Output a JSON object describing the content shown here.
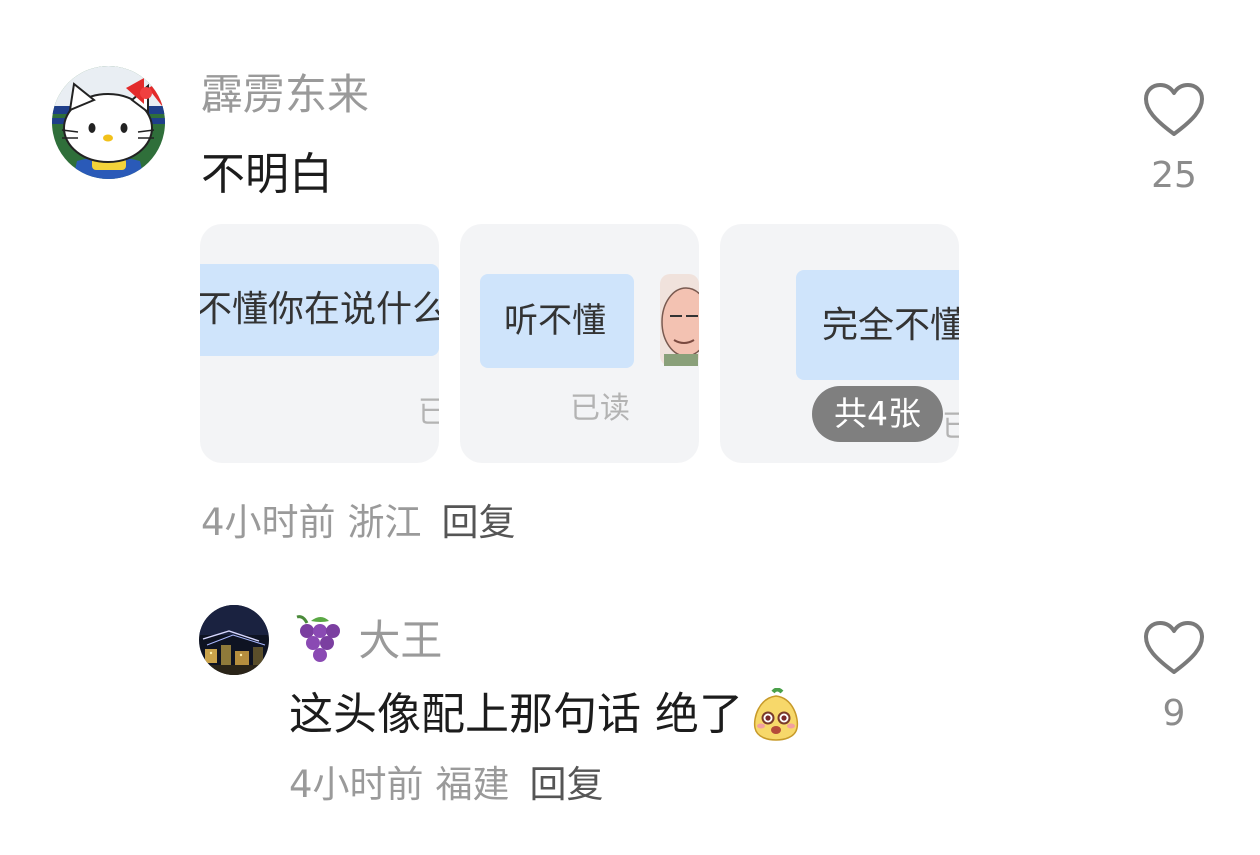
{
  "comments": [
    {
      "username": "霹雳东来",
      "text": "不明白",
      "time": "4小时前",
      "location": "浙江",
      "reply_label": "回复",
      "like_count": "25",
      "images": {
        "thumb1_text": "不懂你在说什么",
        "thumb1_read": "已",
        "thumb2_text": "听不懂",
        "thumb2_read": "已读",
        "thumb3_text": "完全不懂",
        "thumb3_read": "已",
        "count_badge": "共4张"
      }
    },
    {
      "username_emoji": "🍇",
      "username": "大王",
      "text": "这头像配上那句话 绝了",
      "time": "4小时前",
      "location": "福建",
      "reply_label": "回复",
      "like_count": "9"
    }
  ],
  "colors": {
    "username": "#9a9a9a",
    "text": "#1c1c1c",
    "meta": "#9a9a9a",
    "reply": "#555555",
    "bubble": "#cfe4fb",
    "thumb_bg": "#f3f4f6",
    "badge_bg": "#6e6e6e"
  },
  "icons": {
    "like": "heart-outline-icon",
    "avatar_main": "hello-kitty-avatar",
    "avatar_reply": "night-city-avatar",
    "inline_emoji": "pear-face-emoji"
  }
}
